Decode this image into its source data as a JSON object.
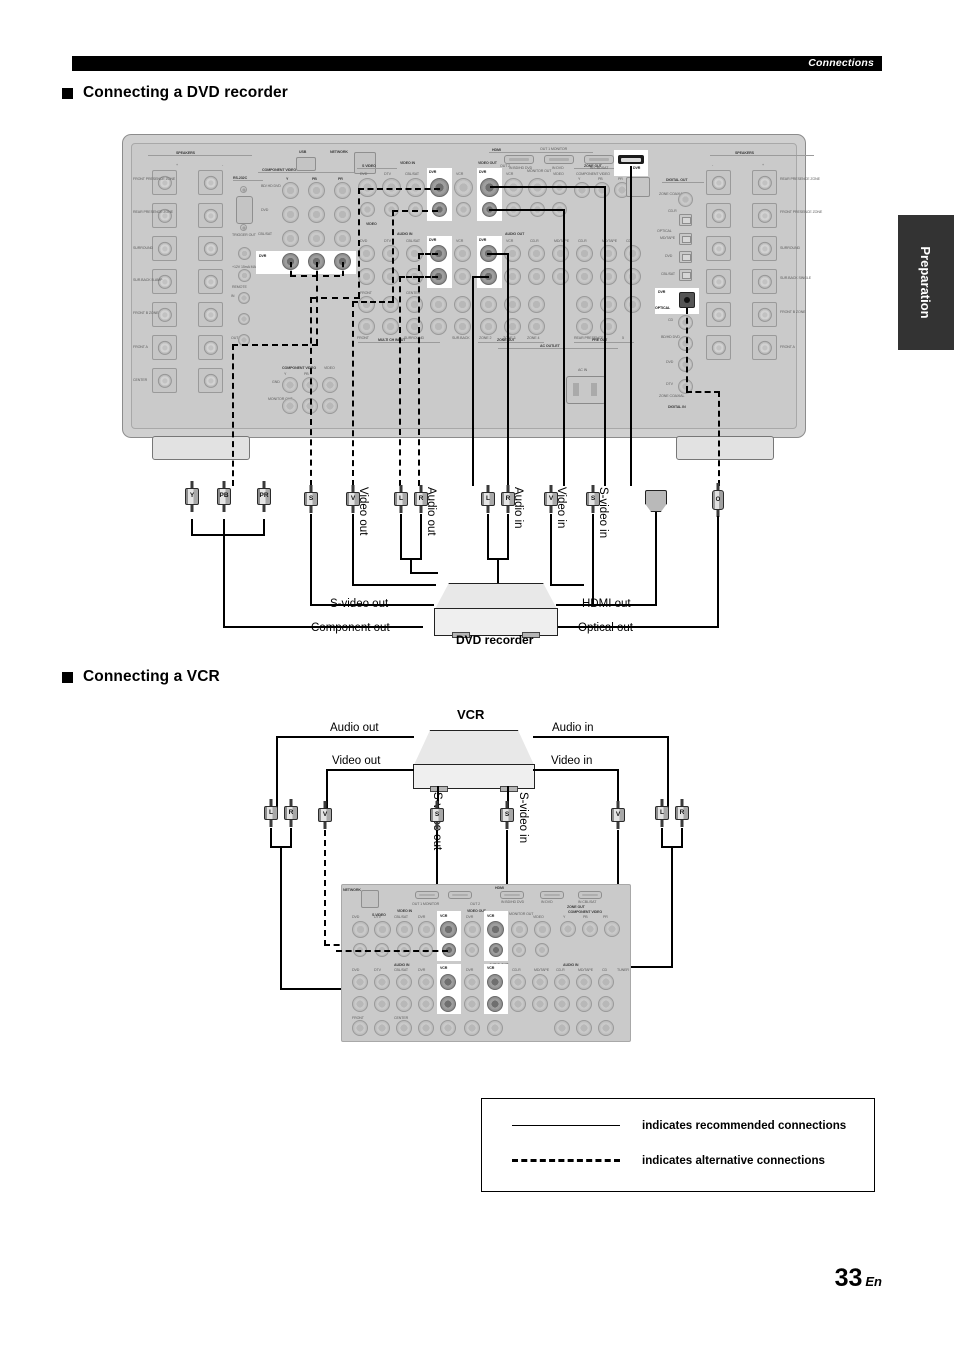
{
  "header": {
    "running_head": "Connections"
  },
  "side_tab": {
    "label": "Preparation"
  },
  "page_footer": {
    "number": "33",
    "lang": "En"
  },
  "sections": [
    {
      "id": "dvd",
      "title": "Connecting a DVD recorder"
    },
    {
      "id": "vcr",
      "title": "Connecting a VCR"
    }
  ],
  "legend": {
    "rows": [
      {
        "style": "solid",
        "label": "indicates recommended connections"
      },
      {
        "style": "dashed",
        "label": "indicates alternative connections"
      }
    ]
  },
  "dvd_diagram": {
    "device_label": "DVD recorder",
    "device_port_labels": [
      "S-video out",
      "Component out",
      "HDMI out",
      "Optical out"
    ],
    "cable_labels": [
      "Video out",
      "Audio out",
      "Audio in",
      "Video in",
      "S-video in"
    ],
    "plugs": [
      {
        "name": "component-y-plug",
        "text": "Y"
      },
      {
        "name": "component-pb-plug",
        "text": "PB"
      },
      {
        "name": "component-pr-plug",
        "text": "PR"
      },
      {
        "name": "s-video-out-plug",
        "text": "S"
      },
      {
        "name": "video-out-plug",
        "text": "V"
      },
      {
        "name": "audio-out-left-plug",
        "text": "L"
      },
      {
        "name": "audio-out-right-plug",
        "text": "R"
      },
      {
        "name": "audio-in-left-plug",
        "text": "L"
      },
      {
        "name": "audio-in-right-plug",
        "text": "R"
      },
      {
        "name": "video-in-plug",
        "text": "V"
      },
      {
        "name": "s-video-in-plug",
        "text": "S"
      },
      {
        "name": "hdmi-plug",
        "text": ""
      },
      {
        "name": "optical-plug",
        "text": "O"
      }
    ]
  },
  "vcr_diagram": {
    "device_label": "VCR",
    "port_labels": {
      "audio_out": "Audio out",
      "audio_in": "Audio in",
      "video_out": "Video out",
      "video_in": "Video in",
      "s_video_out": "S-video out",
      "s_video_in": "S-video in"
    },
    "plugs": [
      {
        "name": "vcr-audio-out-left-plug",
        "text": "L"
      },
      {
        "name": "vcr-audio-out-right-plug",
        "text": "R"
      },
      {
        "name": "vcr-video-out-plug",
        "text": "V"
      },
      {
        "name": "vcr-s-video-out-plug",
        "text": "S"
      },
      {
        "name": "vcr-s-video-in-plug",
        "text": "S"
      },
      {
        "name": "vcr-video-in-plug",
        "text": "V"
      },
      {
        "name": "vcr-audio-in-left-plug",
        "text": "L"
      },
      {
        "name": "vcr-audio-in-right-plug",
        "text": "R"
      }
    ]
  },
  "rear_panel": {
    "groups": {
      "speakers_left": "SPEAKERS",
      "speakers_right": "SPEAKERS",
      "rs232c": "RS-232C",
      "trigger_out": "TRIGGER OUT",
      "remote": "REMOTE",
      "component_video": "COMPONENT VIDEO",
      "usb": "USB",
      "network": "NETWORK",
      "s_video": "S VIDEO",
      "video": "VIDEO",
      "video_in": "VIDEO IN",
      "video_out": "VIDEO OUT",
      "audio_in": "AUDIO IN",
      "audio_out": "AUDIO OUT",
      "multi_ch_input": "MULTI CH INPUT",
      "zone_out": "ZONE OUT",
      "hdmi": "HDMI",
      "dock": "DOCK",
      "digital_out": "DIGITAL OUT",
      "digital_in": "DIGITAL IN",
      "ac_outlet": "AC OUTLET",
      "ac_in": "AC IN",
      "monitor_out": "MONITOR OUT",
      "pre_out": "PRE OUT"
    },
    "component_rows": [
      "BD/ HD DVD",
      "DVD",
      "CBL/SAT",
      "DVR"
    ],
    "component_cols": [
      "Y",
      "PB",
      "PR"
    ],
    "video_sources": [
      "DVD",
      "DTV",
      "CBL/SAT",
      "DVR",
      "VCR"
    ],
    "audio_in_sources": [
      "DVD",
      "DTV",
      "CBL/SAT",
      "DVR",
      "VCR",
      "CD-R",
      "MD/TAPE",
      "CD",
      "TUNER",
      "PHONO"
    ],
    "audio_out_sources": [
      "VCR",
      "CD-R",
      "MD/TAPE"
    ],
    "speaker_labels_left": [
      "FRONT PRESENCE ZONE",
      "REAR PRESENCE ZONE",
      "SURROUND",
      "SUR.BACK B-AMP",
      "FRONT B ZONE",
      "FRONT A",
      "CENTER"
    ],
    "speaker_labels_right": [
      "REAR PRESENCE ZONE",
      "FRONT PRESENCE ZONE",
      "SURROUND",
      "SUR.BACK SINGLE",
      "FRONT B ZONE",
      "FRONT A"
    ],
    "digital_out_labels": [
      "ZONE COAXIAL",
      "CD-R",
      "OPTICAL"
    ],
    "digital_in_optical": [
      "MD/TAPE",
      "DVD",
      "CBL/SAT",
      "DVR"
    ],
    "digital_in_coaxial": [
      "CD",
      "BD/HD DVD",
      "DVD",
      "DTV"
    ],
    "hdmi_ports": [
      "OUT 1 MONITOR",
      "OUT 2",
      "IN BD/HD DVD",
      "IN DVD",
      "IN CBL/SAT",
      "IN DVR"
    ],
    "zone_labels": [
      "ZONE 2",
      "ZONE 3",
      "ZONE 4"
    ],
    "pre_out_labels": [
      "FRONT",
      "SURROUND",
      "CENTER",
      "REAR PRESENCE",
      "SUR.BACK",
      "FRONT PRESENCE",
      "REAR PRESENCE"
    ],
    "misc": [
      "+",
      "-",
      "+12V 15mA MAX.",
      "IN",
      "OUT",
      "GND",
      "1",
      "2",
      "3",
      "4",
      "5",
      "6",
      "7",
      "8"
    ],
    "highlight_name": "DVR",
    "highlight_name_vcr": "VCR"
  }
}
